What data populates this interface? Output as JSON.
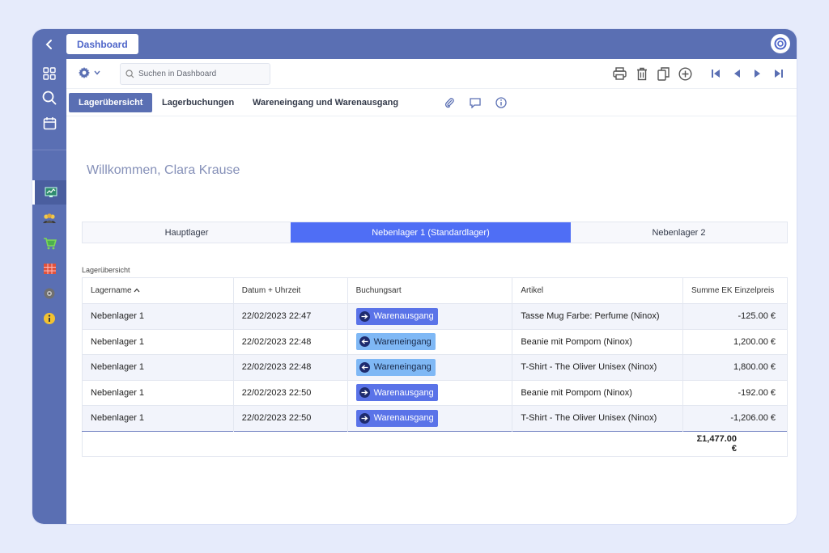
{
  "topbar": {
    "dashboard_tab": "Dashboard"
  },
  "sidebar": {
    "items": [
      {
        "icon": "grid-icon"
      },
      {
        "icon": "search-icon"
      },
      {
        "icon": "calendar-icon"
      },
      {
        "icon": "monitor-chart-icon",
        "active": true
      },
      {
        "icon": "people-icon"
      },
      {
        "icon": "cart-icon"
      },
      {
        "icon": "warehouse-icon"
      },
      {
        "icon": "gear-icon"
      },
      {
        "icon": "info-icon"
      }
    ]
  },
  "toolbar": {
    "search_placeholder": "Suchen in Dashboard"
  },
  "tabs": [
    {
      "label": "Lagerübersicht",
      "active": true
    },
    {
      "label": "Lagerbuchungen"
    },
    {
      "label": "Wareneingang und Warenausgang"
    }
  ],
  "welcome": "Willkommen, Clara Krause",
  "segments": [
    {
      "label": "Hauptlager"
    },
    {
      "label": "Nebenlager 1 (Standardlager)",
      "active": true
    },
    {
      "label": "Nebenlager 2"
    }
  ],
  "section_label": "Lagerübersicht",
  "table": {
    "headers": [
      "Lagername",
      "Datum + Uhrzeit",
      "Buchungsart",
      "Artikel",
      "Summe EK Einzelpreis"
    ],
    "rows": [
      {
        "lager": "Nebenlager 1",
        "datum": "22/02/2023 22:47",
        "art": "Warenausgang",
        "artikel": "Tasse Mug Farbe: Perfume (Ninox)",
        "summe": "-125.00 €"
      },
      {
        "lager": "Nebenlager 1",
        "datum": "22/02/2023 22:48",
        "art": "Wareneingang",
        "artikel": "Beanie mit Pompom (Ninox)",
        "summe": "1,200.00 €"
      },
      {
        "lager": "Nebenlager 1",
        "datum": "22/02/2023 22:48",
        "art": "Wareneingang",
        "artikel": "T-Shirt - The Oliver Unisex (Ninox)",
        "summe": "1,800.00 €"
      },
      {
        "lager": "Nebenlager 1",
        "datum": "22/02/2023 22:50",
        "art": "Warenausgang",
        "artikel": "Beanie mit Pompom (Ninox)",
        "summe": "-192.00 €"
      },
      {
        "lager": "Nebenlager 1",
        "datum": "22/02/2023 22:50",
        "art": "Warenausgang",
        "artikel": "T-Shirt - The Oliver Unisex (Ninox)",
        "summe": "-1,206.00 €"
      }
    ],
    "total": "Σ1,477.00 €"
  },
  "colors": {
    "brand": "#5a6fb3",
    "accent": "#4f6ef5",
    "badge_out": "#5a73e8",
    "badge_in": "#7fb8f5"
  }
}
